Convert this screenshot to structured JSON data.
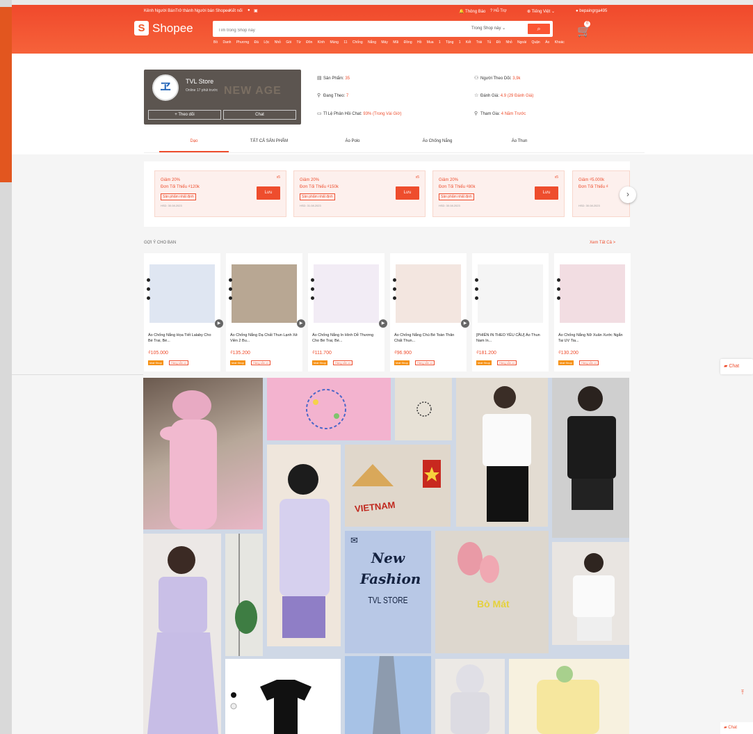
{
  "colors": {
    "brand": "#ee4d2d",
    "header": "#f6623a"
  },
  "topbar": {
    "seller_center": "Kênh Người Bán",
    "become_seller": "Trở thành Người bán Shopee",
    "connect": "Kết nối",
    "notifications": "Thông Báo",
    "help": "Hỗ Trợ",
    "language": "Tiếng Việt",
    "username": "bepaingrga495"
  },
  "header": {
    "logo_text": "Shopee",
    "search_placeholder": "Tìm trong Shop này",
    "search_scope": "Trong Shop này",
    "cart_count": "0",
    "suggestions": "Bồ Danh Phương Đá  Lộc Nhỏ Gói Từ  Đôn Kính Mùng 11 Chống Nắng  Máy Mũi  Đồng Hồ  Mua 1 Tặng 1 Kết Trái  Tủ Đồ Nhỏ Ngoài Quận  Áo Khoác"
  },
  "shop": {
    "name": "TVL Store",
    "status": "Online 17 phút trước",
    "watermark": "NEW AGE",
    "follow_label": "+ Theo dõi",
    "chat_label": "Chat",
    "stats": [
      {
        "icon": "store-icon",
        "label": "Sản Phẩm:",
        "value": "35"
      },
      {
        "icon": "person-icon",
        "label": "Đang Theo:",
        "value": "7"
      },
      {
        "icon": "chat-icon",
        "label": "Tỉ Lệ Phản Hồi Chat:",
        "value": "93% (Trong Vài Giờ)"
      },
      {
        "icon": "followers-icon",
        "label": "Người Theo Dõi:",
        "value": "3,9k"
      },
      {
        "icon": "star-icon",
        "label": "Đánh Giá:",
        "value": "4.9 (29 Đánh Giá)"
      },
      {
        "icon": "join-icon",
        "label": "Tham Gia:",
        "value": "4 Năm Trước"
      }
    ]
  },
  "tabs": [
    "Dạo",
    "TẤT CẢ SẢN PHẨM",
    "Áo Polo",
    "Áo Chống Nắng",
    "Áo Thun"
  ],
  "vouchers": [
    {
      "title": "Giảm 20%",
      "min": "Đơn Tối Thiểu ₫120k",
      "tag": "Sản phẩm nhất định",
      "exp": "HSD: 30.08.2023",
      "qty": "x5",
      "btn": "Lưu"
    },
    {
      "title": "Giảm 20%",
      "min": "Đơn Tối Thiểu ₫150k",
      "tag": "Sản phẩm nhất định",
      "exp": "HSD: 31.08.2023",
      "qty": "x5",
      "btn": "Lưu"
    },
    {
      "title": "Giảm 20%",
      "min": "Đơn Tối Thiểu ₫80k",
      "tag": "Sản phẩm nhất định",
      "exp": "HSD: 30.08.2023",
      "qty": "x5",
      "btn": "Lưu"
    }
  ],
  "voucher_partial": {
    "title": "Giảm ₫5.000k",
    "min": "Đơn Tối Thiểu ₫",
    "exp": "HSD: 30.08.2023"
  },
  "recommend": {
    "title": "GỢI Ý CHO BẠN",
    "see_all": "Xem Tất Cả >"
  },
  "products": [
    {
      "name": "Áo Chống Nắng Họa Tiết Lalaby Cho Bé Trai, Bé...",
      "price": "₫105.000",
      "badge": "Mall Shop",
      "tag": "Hàng sẵn có"
    },
    {
      "name": "Áo Chống Nắng Dạ Chất Thun Lạnh Xẻ Viền 2 Bu...",
      "price": "₫135.200",
      "badge": "Mall Shop",
      "tag": "Hàng sẵn có"
    },
    {
      "name": "Áo Chống Nắng In Hình Dễ Thương Cho Bé Trai, Bé...",
      "price": "₫111.700",
      "badge": "Mall Shop",
      "tag": "Hàng sẵn có"
    },
    {
      "name": "Áo Chống Nắng Chú Bé Toàn Thân Chất Thun...",
      "price": "₫96.900",
      "badge": "Mall Shop",
      "tag": "Hàng sẵn có"
    },
    {
      "name": "[PHIÊN IN THEO YÊU CẦU] Áo Thun Nam In...",
      "price": "₫181.200",
      "badge": "Mall Shop",
      "tag": "Hàng sẵn có"
    },
    {
      "name": "Áo Chống Nắng Nữ Xuân Xước Ngắn Tai UV Tia...",
      "price": "₫130.200",
      "badge": "Mall Shop",
      "tag": "Hàng sẵn có"
    }
  ],
  "banner": {
    "title": "New Fashion",
    "store": "TVL STORE",
    "vietnam": "VIETNAM",
    "yellow_text": "Bò Mát"
  },
  "chat_label": "Chat"
}
